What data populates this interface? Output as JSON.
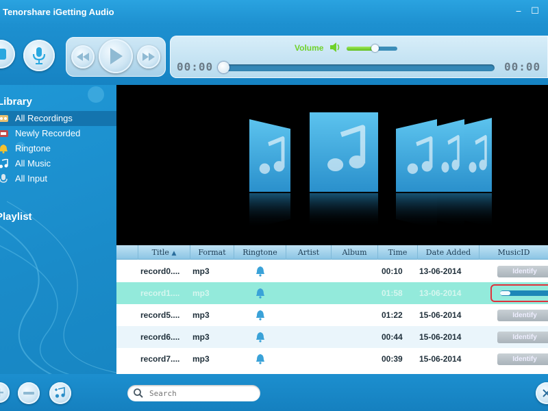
{
  "app": {
    "title": "Tenorshare iGetting Audio"
  },
  "toolbar": {
    "volume_label": "Volume",
    "volume_level": 0.55,
    "time_start": "00:00",
    "time_end": "00:00",
    "seek_progress": 0.0
  },
  "sidebar": {
    "library_title": "Library",
    "items": [
      {
        "label": "All Recordings",
        "icon": "recordings-icon",
        "selected": true
      },
      {
        "label": "Newly Recorded",
        "icon": "new-record-icon",
        "selected": false
      },
      {
        "label": "Ringtone",
        "icon": "bell-icon",
        "selected": false
      },
      {
        "label": "All Music",
        "icon": "music-icon",
        "selected": false
      },
      {
        "label": "All Input",
        "icon": "microphone-icon",
        "selected": false
      }
    ],
    "playlist_title": "Playlist"
  },
  "table": {
    "columns": [
      "Title",
      "Format",
      "Ringtone",
      "Artist",
      "Album",
      "Time",
      "Date Added",
      "MusicID"
    ],
    "sort_column": "Title",
    "rows": [
      {
        "title": "record0....",
        "format": "mp3",
        "time": "00:10",
        "date": "13-06-2014",
        "identify": "Identify",
        "state": "normal"
      },
      {
        "title": "record1....",
        "format": "mp3",
        "time": "01:58",
        "date": "13-06-2014",
        "identify": "",
        "state": "identifying",
        "progress": 0.2
      },
      {
        "title": "record5....",
        "format": "mp3",
        "time": "01:22",
        "date": "15-06-2014",
        "identify": "Identify",
        "state": "normal"
      },
      {
        "title": "record6....",
        "format": "mp3",
        "time": "00:44",
        "date": "15-06-2014",
        "identify": "Identify",
        "state": "normal"
      },
      {
        "title": "record7....",
        "format": "mp3",
        "time": "00:39",
        "date": "15-06-2014",
        "identify": "Identify",
        "state": "normal"
      }
    ]
  },
  "search": {
    "placeholder": "Search"
  },
  "colors": {
    "accent": "#1a8fcf",
    "highlight_row": "#93eadb",
    "volume": "#6fd12a"
  }
}
